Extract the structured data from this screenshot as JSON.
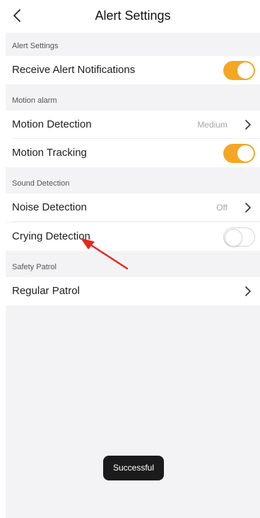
{
  "header": {
    "title": "Alert Settings",
    "back_icon": "chevron-left-icon"
  },
  "sections": {
    "alert": {
      "header": "Alert Settings",
      "items": [
        {
          "label": "Receive Alert Notifications",
          "control": "toggle",
          "state": "on"
        }
      ]
    },
    "motion": {
      "header": "Motion alarm",
      "items": [
        {
          "label": "Motion Detection",
          "value": "Medium",
          "control": "chevron"
        },
        {
          "label": "Motion Tracking",
          "control": "toggle",
          "state": "on"
        }
      ]
    },
    "sound": {
      "header": "Sound Detection",
      "items": [
        {
          "label": "Noise Detection",
          "value": "Off",
          "control": "chevron"
        },
        {
          "label": "Crying Detection",
          "control": "toggle",
          "state": "off"
        }
      ]
    },
    "patrol": {
      "header": "Safety Patrol",
      "items": [
        {
          "label": "Regular Patrol",
          "control": "chevron"
        }
      ]
    }
  },
  "toast": {
    "text": "Successful"
  },
  "colors": {
    "accent": "#f5a623",
    "background": "#f3f3f5",
    "annotation": "#e8261c"
  }
}
